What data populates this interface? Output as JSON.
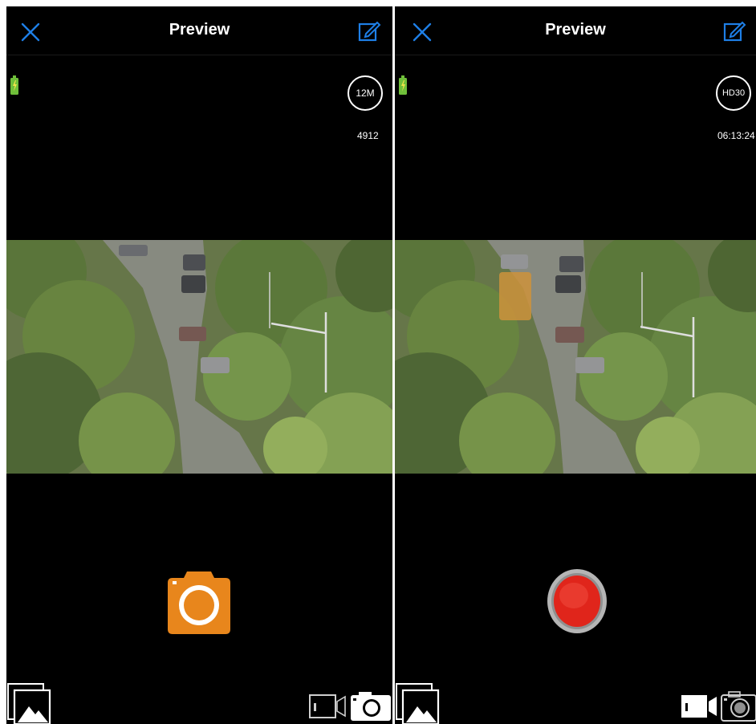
{
  "left_screen": {
    "title": "Preview",
    "resolution_badge": "12M",
    "photo_count": "4912",
    "mode": "photo",
    "icons": {
      "close": "close-icon",
      "edit": "edit-icon",
      "battery": "battery-charging-icon",
      "shutter": "camera-shutter-icon",
      "gallery": "gallery-icon",
      "mode_video": "video-mode-icon",
      "mode_photo": "photo-mode-icon"
    }
  },
  "right_screen": {
    "title": "Preview",
    "resolution_badge": "HD30",
    "remaining_time": "06:13:24",
    "mode": "video",
    "icons": {
      "close": "close-icon",
      "edit": "edit-icon",
      "battery": "battery-charging-icon",
      "shutter": "record-button-icon",
      "gallery": "gallery-icon",
      "mode_video": "video-mode-icon",
      "mode_photo": "photo-mode-icon"
    }
  },
  "colors": {
    "accent": "#1e7fe6",
    "photo_shutter": "#e8861c",
    "record_red": "#e0251b",
    "record_ring": "#b5b5b5",
    "battery_green": "#6fbf3a"
  }
}
